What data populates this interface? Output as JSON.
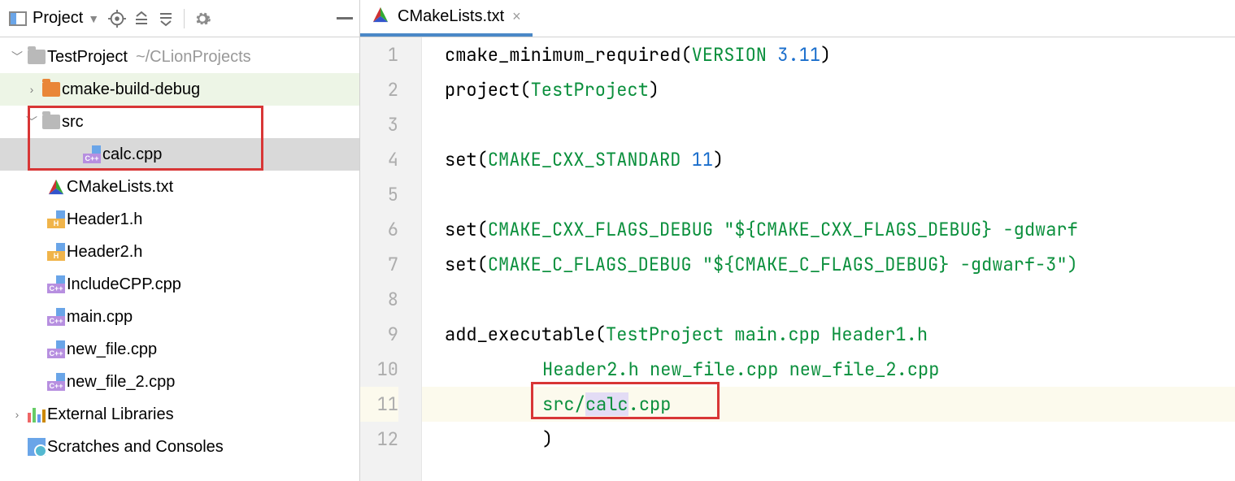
{
  "toolbar": {
    "project_label": "Project"
  },
  "tree": {
    "root": {
      "name": "TestProject",
      "path": "~/CLionProjects"
    },
    "cmake_build": "cmake-build-debug",
    "src": "src",
    "calc": "calc.cpp",
    "cmakelists": "CMakeLists.txt",
    "header1": "Header1.h",
    "header2": "Header2.h",
    "includecpp": "IncludeCPP.cpp",
    "main": "main.cpp",
    "newfile": "new_file.cpp",
    "newfile2": "new_file_2.cpp",
    "external": "External Libraries",
    "scratches": "Scratches and Consoles"
  },
  "editor": {
    "tab_name": "CMakeLists.txt",
    "gutter": [
      "1",
      "2",
      "3",
      "4",
      "5",
      "6",
      "7",
      "8",
      "9",
      "10",
      "11",
      "12"
    ],
    "code": {
      "l1_fn": "cmake_minimum_required",
      "l1_a": "(",
      "l1_kw": "VERSION",
      "l1_sp": " ",
      "l1_num": "3.11",
      "l1_b": ")",
      "l2_fn": "project",
      "l2_a": "(",
      "l2_arg": "TestProject",
      "l2_b": ")",
      "l4_fn": "set",
      "l4_a": "(",
      "l4_kw": "CMAKE_CXX_STANDARD",
      "l4_sp": " ",
      "l4_num": "11",
      "l4_b": ")",
      "l6_fn": "set",
      "l6_a": "(",
      "l6_kw": "CMAKE_CXX_FLAGS_DEBUG",
      "l6_sp": " ",
      "l6_q1": "\"",
      "l6_var": "${CMAKE_CXX_FLAGS_DEBUG}",
      "l6_tail": " -gdwarf",
      "l7_fn": "set",
      "l7_a": "(",
      "l7_kw": "CMAKE_C_FLAGS_DEBUG",
      "l7_sp": " ",
      "l7_q1": "\"",
      "l7_var": "${CMAKE_C_FLAGS_DEBUG}",
      "l7_tail": " -gdwarf-3\")",
      "l9_fn": "add_executable",
      "l9_a": "(",
      "l9_args": "TestProject main.cpp Header1.h",
      "l10_args": "Header2.h new_file.cpp new_file_2.cpp",
      "l11_a": "src/",
      "l11_b": "calc",
      "l11_c": ".cpp",
      "l12": ")"
    }
  }
}
